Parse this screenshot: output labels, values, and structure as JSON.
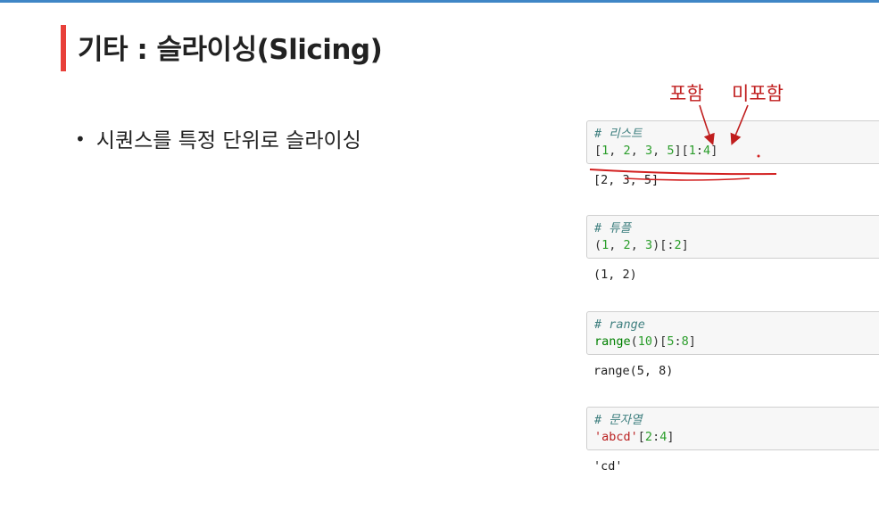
{
  "slide": {
    "title": "기타 : 슬라이싱(Slicing)",
    "bullet": "시퀀스를 특정 단위로 슬라이싱"
  },
  "annotations": {
    "included": "포함",
    "excluded": "미포함"
  },
  "cells": [
    {
      "comment": "# 리스트",
      "output": "[2, 3, 5]"
    },
    {
      "comment": "# 튜플",
      "output": "(1, 2)"
    },
    {
      "comment": "# range",
      "output": "range(5, 8)"
    },
    {
      "comment": "# 문자열",
      "output": "'cd'"
    }
  ]
}
